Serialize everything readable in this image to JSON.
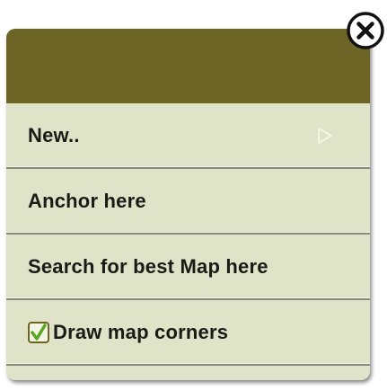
{
  "menu": {
    "items": [
      {
        "label": "New..",
        "has_submenu": true
      },
      {
        "label": "Anchor here"
      },
      {
        "label": "Search for best Map here"
      },
      {
        "label": "Draw map corners",
        "checked": true
      }
    ]
  },
  "icons": {
    "close": "close-icon",
    "submenu": "submenu-arrow-icon",
    "checkbox": "checkbox-checked-icon"
  },
  "colors": {
    "header": "#6c6526",
    "menu_background": "#dfe3c7",
    "checkmark": "#5aa51f"
  }
}
